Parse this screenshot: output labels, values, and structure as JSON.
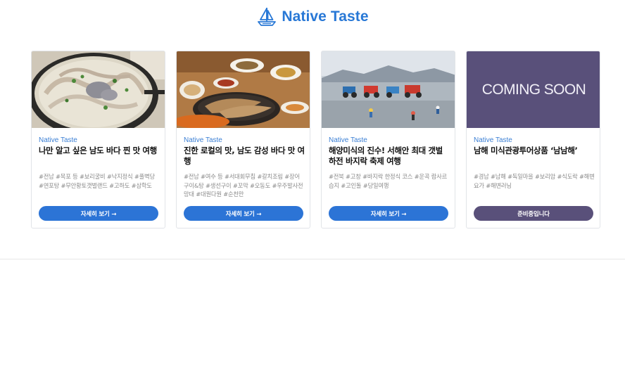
{
  "header": {
    "brand": "Native Taste",
    "logo_icon": "sailboat-icon",
    "brand_color": "#2878d6"
  },
  "cards": [
    {
      "brand": "Native Taste",
      "title": "나만 알고 싶은 남도 바다 찐 맛 여행",
      "tags": "#전남 #목포 등 #보리굴비 #낙지정식 #풀벽당 #연포탕 #무안황토갯벌랜드 #고하도 #삼학도",
      "button": "자세히 보기 →",
      "image": "octopus-hotpot-photo"
    },
    {
      "brand": "Native Taste",
      "title": "진한 로컬의 맛, 남도 감성 바다 맛 여행",
      "tags": "#전남 #여수 등 #서대회무침 #갈치조림 #장어구이&탕 #생선구이 #꼬막 #오동도 #우주발사전망대 #대원다원 #순천만",
      "button": "자세히 보기 →",
      "image": "grilled-fish-table-photo"
    },
    {
      "brand": "Native Taste",
      "title": "해양미식의 진수! 서해안 최대 갯벌 하전 바지락 축제 여행",
      "tags": "#전북 #고창 #바지락 한정식 코스 #운곡 람사르습지 #고인돌 #당일여행",
      "button": "자세히 보기 →",
      "image": "mudflat-tractors-photo"
    },
    {
      "brand": "Native Taste",
      "title": "남해 미식관광투어상품 ‘남남해’",
      "tags": "#경남 #남해 #독일마을 #보리암 #식도락 #해변요가 #해변러닝",
      "button": "준비중입니다",
      "image_text": "COMING SOON",
      "image_bg": "#59507a"
    }
  ]
}
